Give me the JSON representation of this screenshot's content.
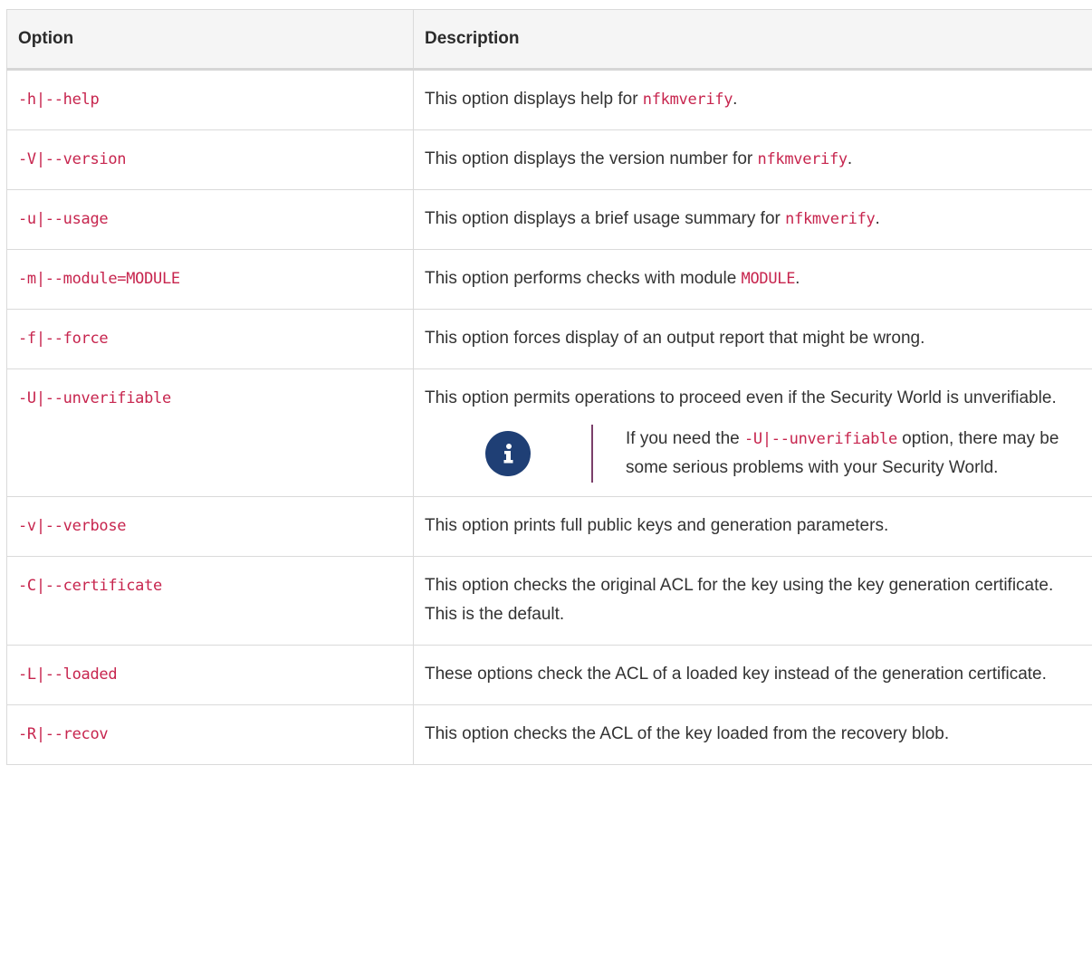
{
  "table": {
    "headers": {
      "option": "Option",
      "description": "Description"
    },
    "rows": [
      {
        "option": "-h|--help",
        "desc_before": "This option displays help for ",
        "desc_code": "nfkmverify",
        "desc_after": "."
      },
      {
        "option": "-V|--version",
        "desc_before": "This option displays the version number for ",
        "desc_code": "nfkmverify",
        "desc_after": "."
      },
      {
        "option": "-u|--usage",
        "desc_before": "This option displays a brief usage summary for ",
        "desc_code": "nfkmverify",
        "desc_after": "."
      },
      {
        "option": "-m|--module=MODULE",
        "desc_before": "This option performs checks with module ",
        "desc_code": "MODULE",
        "desc_after": "."
      },
      {
        "option": "-f|--force",
        "desc": "This option forces display of an output report that might be wrong."
      },
      {
        "option": "-U|--unverifiable",
        "desc": "This option permits operations to proceed even if the Security World is unverifiable.",
        "note": {
          "icon": "info-icon",
          "before": "If you need the ",
          "code": "-U|--unverifiable",
          "after": " option, there may be some serious problems with your Security World."
        }
      },
      {
        "option": "-v|--verbose",
        "desc": "This option prints full public keys and generation parameters."
      },
      {
        "option": "-C|--certificate",
        "desc": "This option checks the original ACL for the key using the key generation certificate. This is the default."
      },
      {
        "option": "-L|--loaded",
        "desc": "These options check the ACL of a loaded key instead of the generation certificate."
      },
      {
        "option": "-R|--recov",
        "desc": "This option checks the ACL of the key loaded from the recovery blob."
      }
    ]
  },
  "colors": {
    "code": "#c7254e",
    "note_icon_bg": "#1f3f75",
    "note_rule": "#7a3f6a"
  }
}
